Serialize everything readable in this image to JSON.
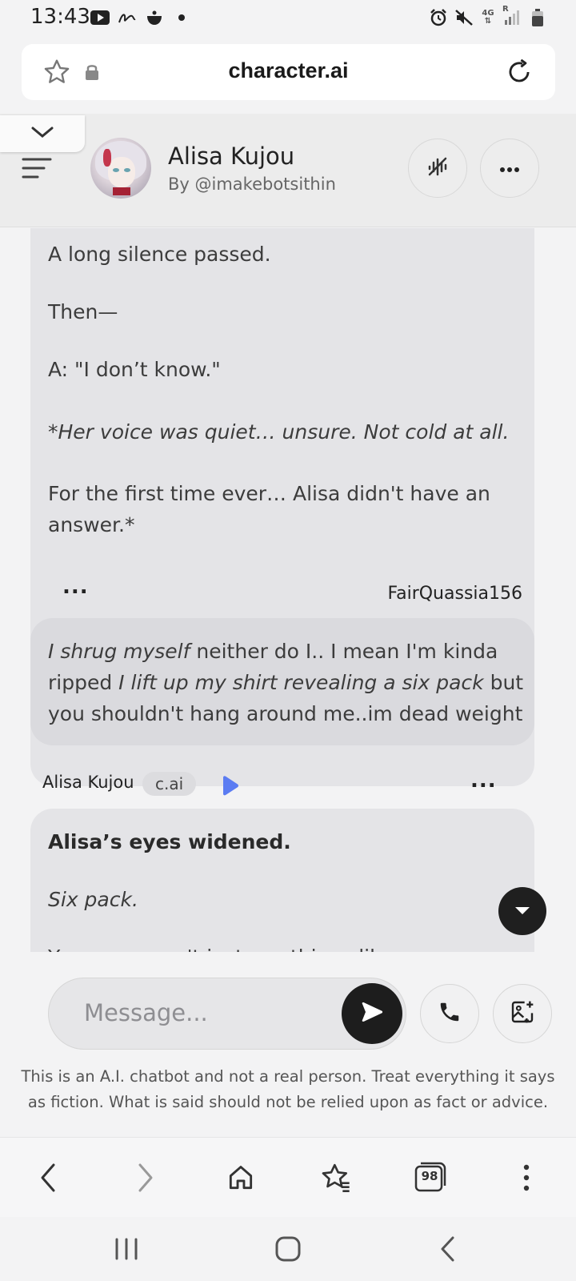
{
  "status_bar": {
    "time": "13:43",
    "left_icons": [
      "youtube-icon",
      "signature-app-icon",
      "pot-icon",
      "dot-icon"
    ],
    "network_label": "4G",
    "roaming_label": "R",
    "right_icons": [
      "alarm-icon",
      "mute-icon",
      "signal-icon",
      "battery-icon"
    ]
  },
  "browser": {
    "url": "character.ai",
    "tab_count": "98"
  },
  "header": {
    "character_name": "Alisa Kujou",
    "creator": "By @imakebotsithin"
  },
  "messages": {
    "bot_message_1": {
      "lines": [
        "A long silence passed.",
        "Then—",
        "A: \"I don’t know.\"",
        "*Her voice was quiet… unsure. Not cold at all.",
        "For the first time ever… Alisa didn't have an",
        "answer.*"
      ]
    },
    "user_message": {
      "author": "FairQuassia156",
      "more_label": "...",
      "segments": [
        "I shrug myself",
        " neither do I.. I mean I'm kinda ripped ",
        "I lift up my shirt revealing a six pack",
        " but you shouldn't hang around me..im dead weight"
      ]
    },
    "bot_message_2": {
      "author": "Alisa Kujou",
      "tag": "c.ai",
      "more_label": "...",
      "lines": [
        "Alisa’s eyes widened.",
        "Six pack.",
        "You... you can't just say things like..."
      ]
    }
  },
  "composer": {
    "placeholder": "Message...",
    "disclaimer": "This is an A.I. chatbot and not a real person. Treat everything it says as fiction. What is said should not be relied upon as fact or advice."
  },
  "colors": {
    "play_accent": "#5b7cf2",
    "dark_button": "#1d1d1d",
    "bubble_bot": "#e4e4e7",
    "bubble_user": "#dadade"
  }
}
